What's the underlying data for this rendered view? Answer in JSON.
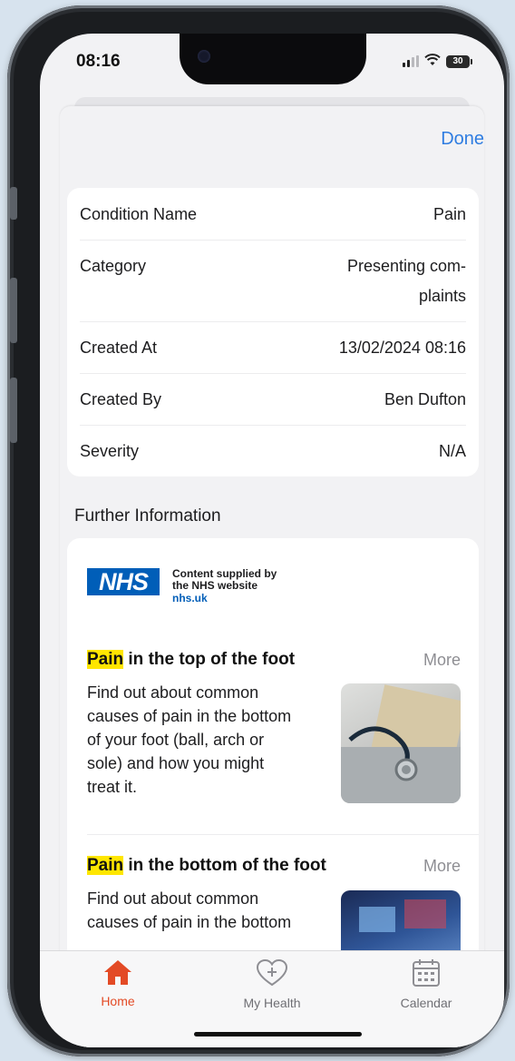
{
  "status_bar": {
    "time": "08:16",
    "battery": "30"
  },
  "header": {
    "done_label": "Done"
  },
  "details": [
    {
      "label": "Condition Name",
      "value": "Pain"
    },
    {
      "label": "Category",
      "value_line1": "Presenting com-",
      "value_line2": "plaints"
    },
    {
      "label": "Created At",
      "value": "13/02/2024 08:16"
    },
    {
      "label": "Created By",
      "value": "Ben Dufton"
    },
    {
      "label": "Severity",
      "value": "N/A"
    }
  ],
  "further_info": {
    "title": "Further Information",
    "nhs": {
      "logo_text": "NHS",
      "supplied_line1": "Content supplied by",
      "supplied_line2": "the NHS website",
      "link": "nhs.uk"
    },
    "articles": [
      {
        "title_highlight": "Pain",
        "title_rest": " in the top of the foot",
        "more_label": "More",
        "description_lines": [
          "Find out about common",
          "causes of pain in the bottom",
          "of your foot (ball, arch or",
          "sole) and how you might",
          "treat it."
        ],
        "image_icon": "stethoscope-photo"
      },
      {
        "title_highlight": "Pain",
        "title_rest": " in the bottom of the foot",
        "more_label": "More",
        "description_lines": [
          "Find out about common",
          "causes of pain in the bottom"
        ],
        "image_icon": "medical-imaging-photo"
      }
    ]
  },
  "tabbar": {
    "tabs": [
      {
        "label": "Home",
        "icon": "house-icon",
        "active": true
      },
      {
        "label": "My Health",
        "icon": "heart-plus-icon",
        "active": false
      },
      {
        "label": "Calendar",
        "icon": "calendar-icon",
        "active": false
      }
    ]
  },
  "colors": {
    "accent": "#2f7de1",
    "active_tab": "#e34a25",
    "nhs_blue": "#005eb8",
    "highlight": "#ffe600"
  }
}
